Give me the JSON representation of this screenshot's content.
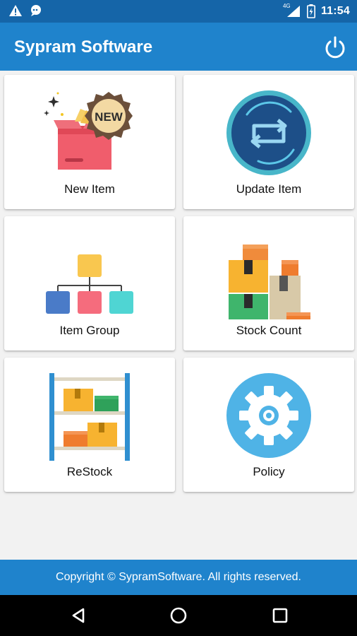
{
  "status_bar": {
    "network_label": "4G",
    "time": "11:54",
    "icons": [
      "warning-icon",
      "chat-bubble-icon",
      "signal-icon",
      "battery-icon"
    ]
  },
  "app_bar": {
    "title": "Sypram Software",
    "action_icon": "power-icon"
  },
  "menu": [
    {
      "label": "New Item",
      "icon": "new-item-icon"
    },
    {
      "label": "Update Item",
      "icon": "update-item-icon"
    },
    {
      "label": "Item Group",
      "icon": "item-group-icon"
    },
    {
      "label": "Stock Count",
      "icon": "stock-count-icon"
    },
    {
      "label": "ReStock",
      "icon": "restock-icon"
    },
    {
      "label": "Policy",
      "icon": "policy-icon"
    }
  ],
  "new_badge": "NEW",
  "footer": {
    "copyright": "Copyright © SypramSoftware. All rights reserved."
  },
  "nav": {
    "icons": [
      "back-icon",
      "home-icon",
      "recents-icon"
    ]
  },
  "colors": {
    "status_bar": "#1565a8",
    "app_bar": "#1f83cc",
    "background": "#f2f2f2"
  }
}
